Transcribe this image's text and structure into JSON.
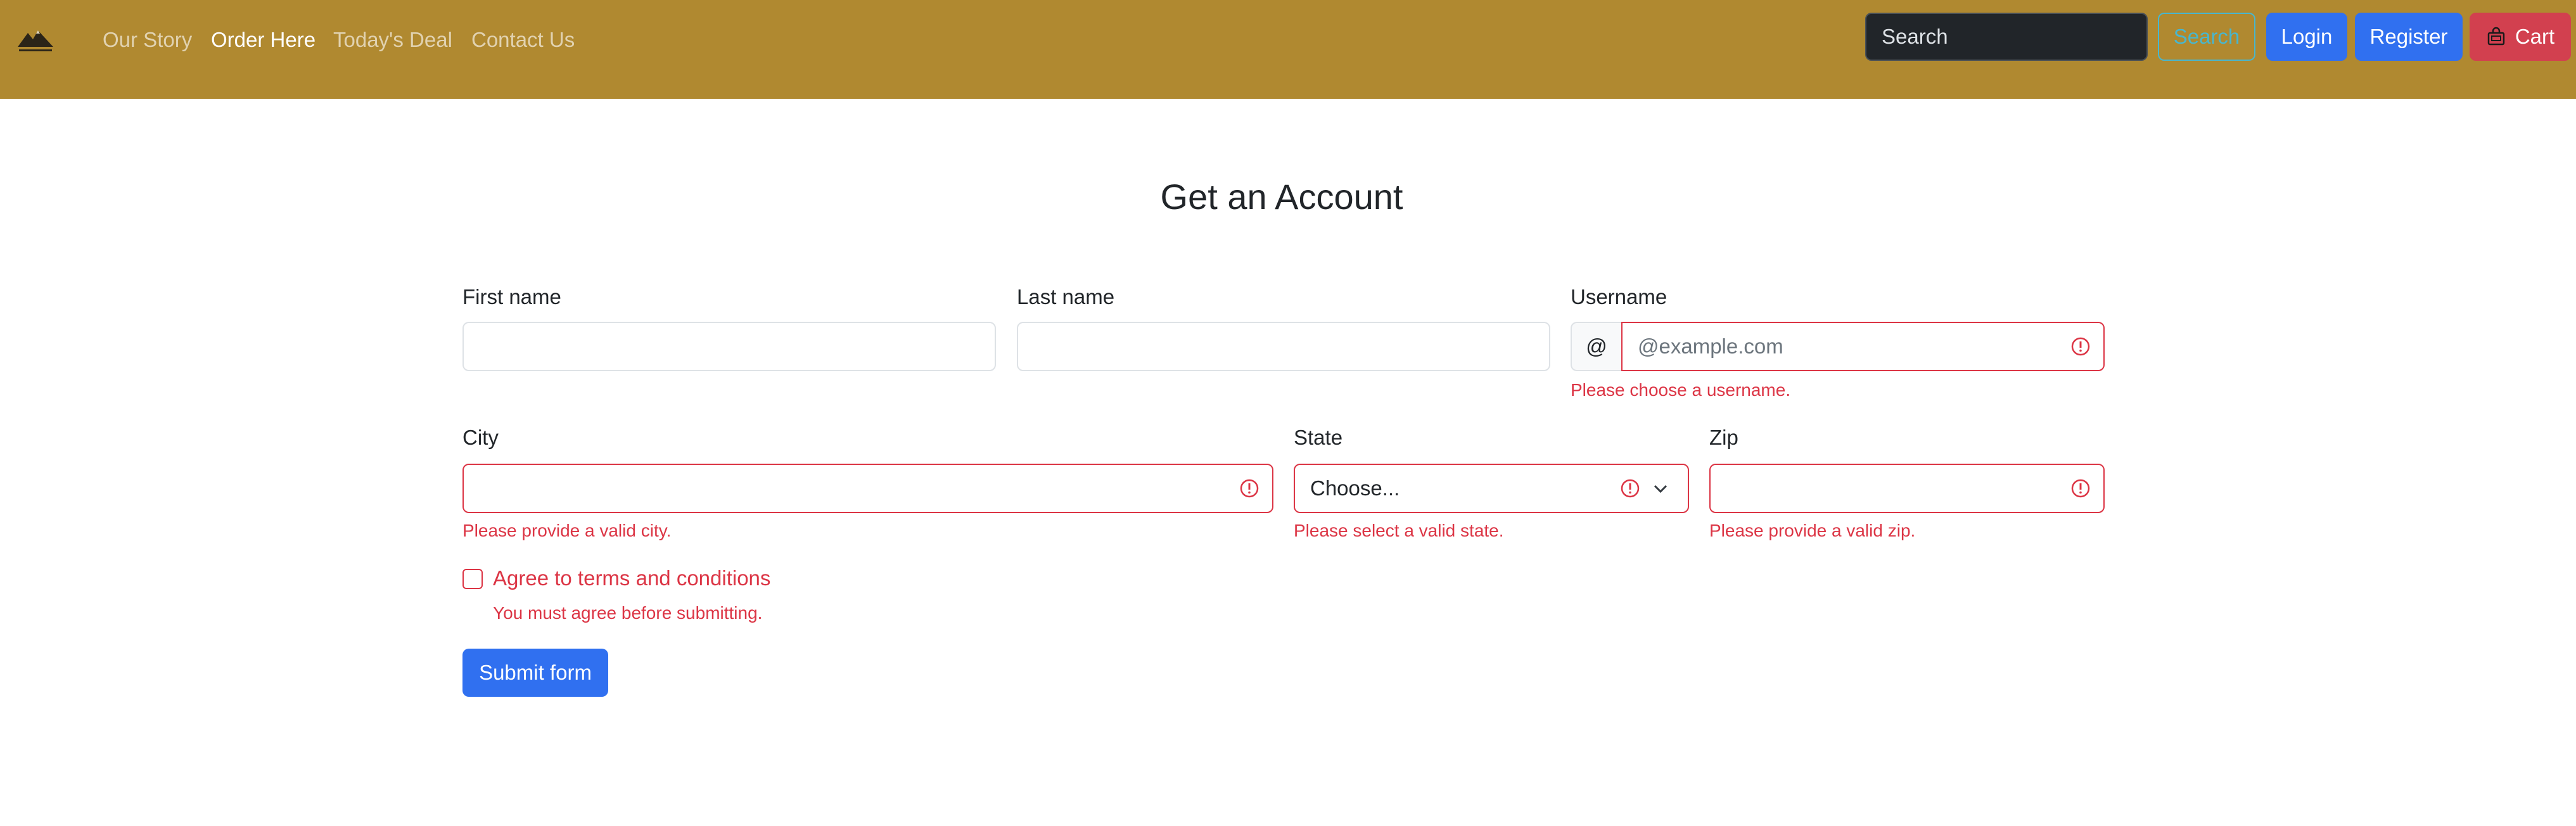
{
  "navbar": {
    "background": "#b08930",
    "brand_icon": "mountain-logo-icon",
    "links": [
      {
        "label": "Our Story",
        "active": false
      },
      {
        "label": "Order Here",
        "active": true
      },
      {
        "label": "Today's Deal",
        "active": false
      },
      {
        "label": "Contact Us",
        "active": false
      }
    ],
    "search_placeholder": "Search",
    "search_button": "Search",
    "login_button": "Login",
    "register_button": "Register",
    "cart_button": "Cart",
    "cart_icon": "cart-icon"
  },
  "form": {
    "title": "Get an Account",
    "first_name": {
      "label": "First name",
      "value": ""
    },
    "last_name": {
      "label": "Last name",
      "value": ""
    },
    "username": {
      "label": "Username",
      "prefix": "@",
      "placeholder": "@example.com",
      "feedback": "Please choose a username."
    },
    "city": {
      "label": "City",
      "value": "",
      "feedback": "Please provide a valid city."
    },
    "state": {
      "label": "State",
      "selected": "Choose...",
      "feedback": "Please select a valid state."
    },
    "zip": {
      "label": "Zip",
      "value": "",
      "feedback": "Please provide a valid zip."
    },
    "terms": {
      "label": "Agree to terms and conditions",
      "checked": false,
      "feedback": "You must agree before submitting."
    },
    "submit_label": "Submit form",
    "error_icon": "alert-circle-icon"
  },
  "colors": {
    "primary": "#3070f0",
    "danger": "#dc3545",
    "info": "#49b6cd",
    "cart": "#d2404f",
    "nav_bg": "#b08930"
  }
}
